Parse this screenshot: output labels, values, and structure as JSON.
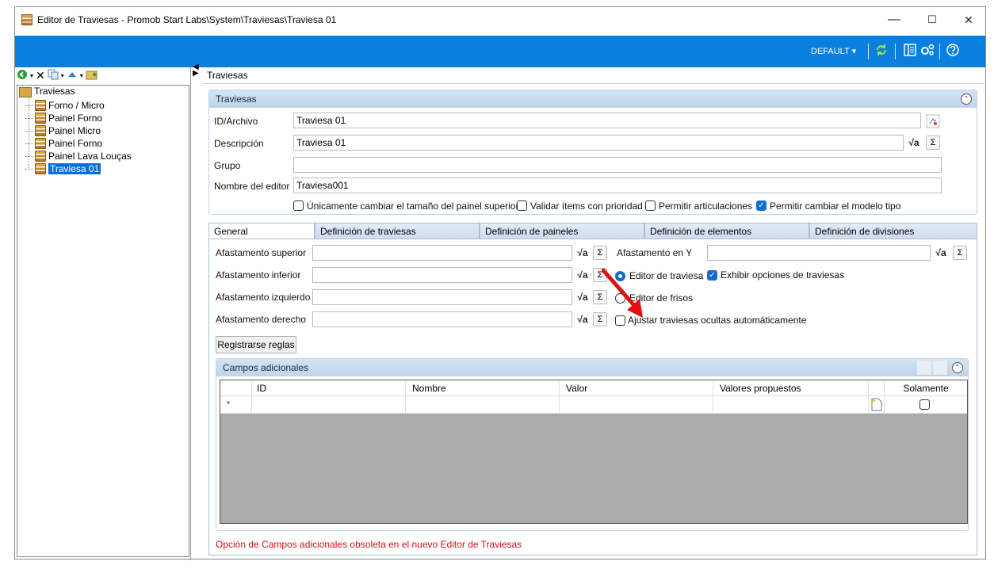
{
  "window": {
    "title": "Editor de Traviesas - Promob Start Labs\\System\\Traviesas\\Traviesa 01",
    "minimize": "—",
    "maximize": "☐",
    "close": "✕"
  },
  "ribbon": {
    "preset_label": "DEFAULT",
    "preset_arrow": "▾",
    "icons": [
      "refresh-icon",
      "panel-icon",
      "settings-icon",
      "help-icon"
    ]
  },
  "left": {
    "toolbar": [
      "back-icon",
      "close-icon",
      "copy-icon",
      "move-up-icon",
      "add-folder-icon"
    ],
    "tree_root": "Traviesas",
    "tree_items": [
      {
        "label": "Forno / Micro",
        "selected": false
      },
      {
        "label": "Painel Forno",
        "selected": false
      },
      {
        "label": "Painel Micro",
        "selected": false
      },
      {
        "label": "Painel Forno",
        "selected": false
      },
      {
        "label": "Painel Lava Louças",
        "selected": false
      },
      {
        "label": "Traviesa 01",
        "selected": true
      }
    ]
  },
  "main": {
    "breadcrumb": "Traviesas",
    "group_title": "Traviesas",
    "fields": {
      "id_label": "ID/Archivo",
      "id_value": "Traviesa 01",
      "desc_label": "Descripción",
      "desc_value": "Traviesa 01",
      "group_label": "Grupo",
      "group_value": "",
      "editor_label": "Nombre del editor",
      "editor_value": "Traviesa001"
    },
    "checkboxes": [
      {
        "label": "Únicamente cambiar el tamaño del painel superior",
        "checked": false
      },
      {
        "label": "Validar ítems con prioridad",
        "checked": false
      },
      {
        "label": "Permitir articulaciones",
        "checked": false
      },
      {
        "label": "Permitir cambiar el modelo tipo",
        "checked": true
      }
    ],
    "tabs": [
      "General",
      "Definición de traviesas",
      "Definición de paineles",
      "Definición de elementos",
      "Definición de divisiones"
    ],
    "general": {
      "sup_label": "Afastamento superior",
      "inf_label": "Afastamento inferior",
      "izq_label": "Afastamento izquierdo",
      "der_label": "Afastamento derecho",
      "y_label": "Afastamento en Y",
      "radio_editor_traviesa": "Editor de traviesa",
      "radio_editor_frisos": "Editor de frisos",
      "exhibir_label": "Exhibir opciones de traviesas",
      "ajustar_label": "Ajustar traviesas ocultas automáticamente",
      "register_button": "Registrarse reglas",
      "sqrt_symbol": "√a",
      "sigma_symbol": "Σ"
    },
    "campos": {
      "title": "Campos adicionales",
      "columns": [
        "ID",
        "Nombre",
        "Valor",
        "Valores propuestos",
        "",
        "Solamente"
      ],
      "new_row_marker": "*"
    },
    "warning": "Opción de Campos adicionales obsoleta en el nuevo Editor de Traviesas"
  },
  "colors": {
    "ribbon": "#0a7fe0",
    "selection": "#0a6ed6",
    "warning": "#d0101c",
    "arrow": "#e01010"
  }
}
